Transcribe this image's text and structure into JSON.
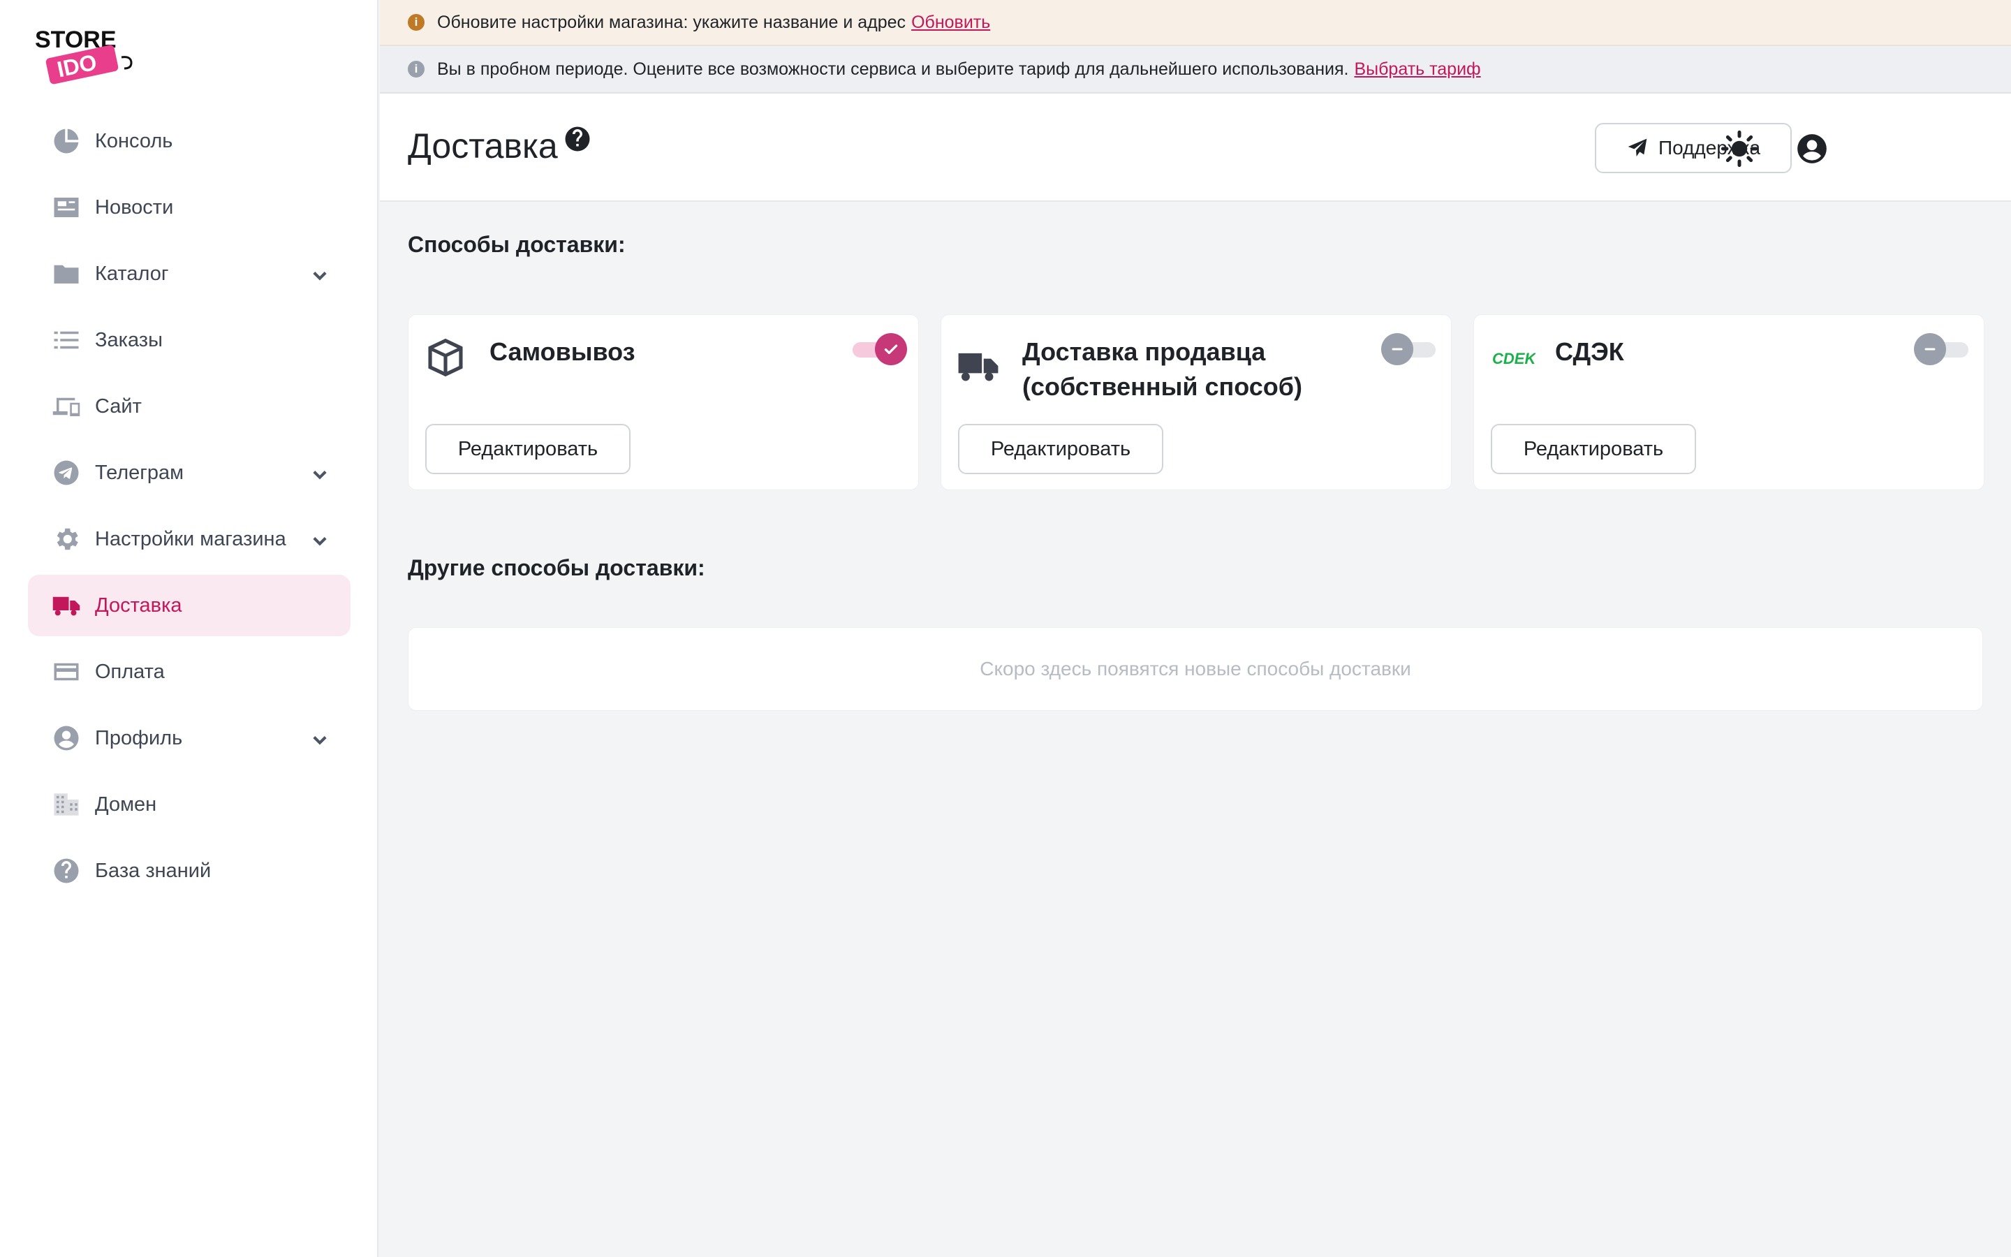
{
  "brand": {
    "line1": "STORE",
    "line2": "IDO",
    "accent": "#e83e8c"
  },
  "colors": {
    "accent": "#c2185b",
    "active_bg": "#fbe9f1",
    "warn": "#c07a26",
    "cdek_green": "#1ab248"
  },
  "sidebar": {
    "items": [
      {
        "label": "Консоль",
        "icon": "pie-chart-icon",
        "has_submenu": false,
        "active": false
      },
      {
        "label": "Новости",
        "icon": "newspaper-icon",
        "has_submenu": false,
        "active": false
      },
      {
        "label": "Каталог",
        "icon": "folder-icon",
        "has_submenu": true,
        "active": false
      },
      {
        "label": "Заказы",
        "icon": "list-icon",
        "has_submenu": false,
        "active": false
      },
      {
        "label": "Сайт",
        "icon": "devices-icon",
        "has_submenu": false,
        "active": false
      },
      {
        "label": "Телеграм",
        "icon": "telegram-icon",
        "has_submenu": true,
        "active": false
      },
      {
        "label": "Настройки магазина",
        "icon": "gear-icon",
        "has_submenu": true,
        "active": false
      },
      {
        "label": "Доставка",
        "icon": "truck-icon",
        "has_submenu": false,
        "active": true
      },
      {
        "label": "Оплата",
        "icon": "credit-card-icon",
        "has_submenu": false,
        "active": false
      },
      {
        "label": "Профиль",
        "icon": "user-circle-icon",
        "has_submenu": true,
        "active": false
      },
      {
        "label": "Домен",
        "icon": "building-icon",
        "has_submenu": false,
        "active": false
      },
      {
        "label": "База знаний",
        "icon": "question-circle-icon",
        "has_submenu": false,
        "active": false
      }
    ]
  },
  "banners": {
    "warning": {
      "text": "Обновите настройки магазина: укажите название и адрес",
      "link": "Обновить"
    },
    "info": {
      "text": "Вы в пробном периоде. Оцените все возможности сервиса и выберите тариф для дальнейшего использования.",
      "link": "Выбрать тариф"
    }
  },
  "header": {
    "title": "Доставка",
    "support_label": "Поддержка"
  },
  "main": {
    "methods_title": "Способы доставки:",
    "other_title": "Другие способы доставки:",
    "empty_text": "Скоро здесь появятся новые способы доставки",
    "cards": [
      {
        "title": "Самовывоз",
        "icon": "box-icon",
        "enabled": true,
        "edit_label": "Редактировать"
      },
      {
        "title": "Доставка продавца (собственный способ)",
        "icon": "truck-icon",
        "enabled": false,
        "edit_label": "Редактировать"
      },
      {
        "title": "СДЭК",
        "icon": "cdek-logo-icon",
        "logo_text": "CDEK",
        "enabled": false,
        "edit_label": "Редактировать"
      }
    ]
  }
}
